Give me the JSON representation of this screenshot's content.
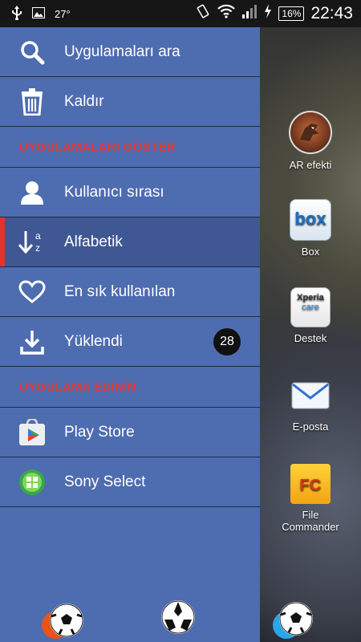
{
  "status_bar": {
    "temperature": "27°",
    "battery": "16%",
    "time": "22:43"
  },
  "drawer": {
    "search_label": "Uygulamaları ara",
    "uninstall_label": "Kaldır",
    "show_apps_header": "UYGULAMALARI GÖSTER",
    "sort_items": [
      {
        "label": "Kullanıcı sırası"
      },
      {
        "label": "Alfabetik"
      },
      {
        "label": "En sık kullanılan"
      },
      {
        "label": "Yüklendi",
        "badge": "28"
      }
    ],
    "get_apps_header": "UYGULAMA EDİNİN",
    "store_items": [
      {
        "label": "Play Store"
      },
      {
        "label": "Sony Select"
      }
    ]
  },
  "apps": [
    {
      "label": "AR efekti",
      "icon": "ar-effect-icon"
    },
    {
      "label": "Box",
      "icon": "box-icon",
      "icon_text": "box"
    },
    {
      "label": "Destek",
      "icon": "xperia-care-icon",
      "icon_text": "Xperia",
      "icon_subtext": "care"
    },
    {
      "label": "E-posta",
      "icon": "email-icon"
    },
    {
      "label": "File",
      "label2": "Commander",
      "icon": "file-commander-icon",
      "icon_text": "FC"
    }
  ],
  "colors": {
    "drawer_bg": "#4e6cb0",
    "selected_bg": "#3f5793",
    "accent_red": "#e2322e",
    "header_red": "#e53935"
  }
}
